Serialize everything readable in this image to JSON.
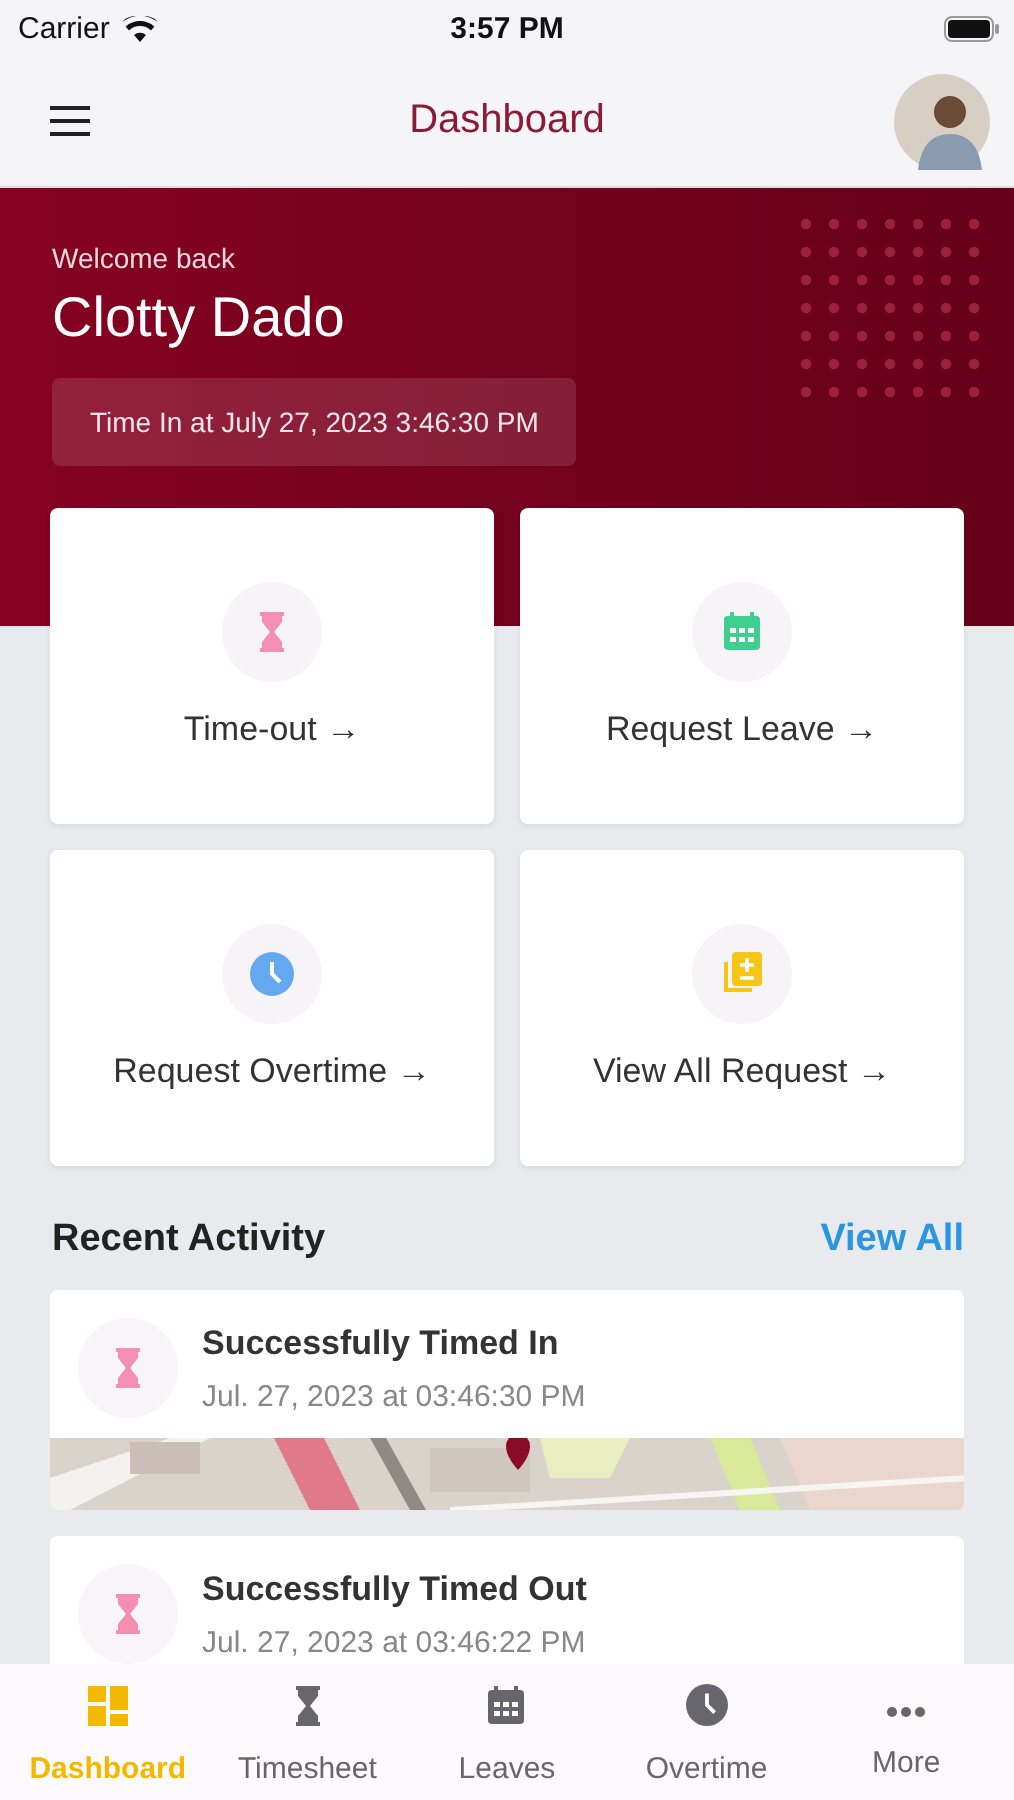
{
  "status_bar": {
    "carrier": "Carrier",
    "time": "3:57 PM"
  },
  "header": {
    "title": "Dashboard"
  },
  "banner": {
    "greeting": "Welcome back",
    "name": "Clotty Dado",
    "time_in": "Time In at July 27, 2023 3:46:30 PM"
  },
  "actions": [
    {
      "label": "Time-out",
      "arrow": "→"
    },
    {
      "label": "Request Leave",
      "arrow": "→"
    },
    {
      "label": "Request Overtime",
      "arrow": "→"
    },
    {
      "label": "View All Request",
      "arrow": "→"
    }
  ],
  "recent_activity": {
    "title": "Recent Activity",
    "link": "View All",
    "items": [
      {
        "title": "Successfully Timed In",
        "time": "Jul. 27, 2023 at 03:46:30 PM"
      },
      {
        "title": "Successfully Timed Out",
        "time": "Jul. 27, 2023 at 03:46:22 PM"
      }
    ]
  },
  "tab_bar": [
    {
      "label": "Dashboard",
      "selected": true
    },
    {
      "label": "Timesheet",
      "selected": false
    },
    {
      "label": "Leaves",
      "selected": false
    },
    {
      "label": "Overtime",
      "selected": false
    },
    {
      "label": "More",
      "selected": false
    }
  ]
}
